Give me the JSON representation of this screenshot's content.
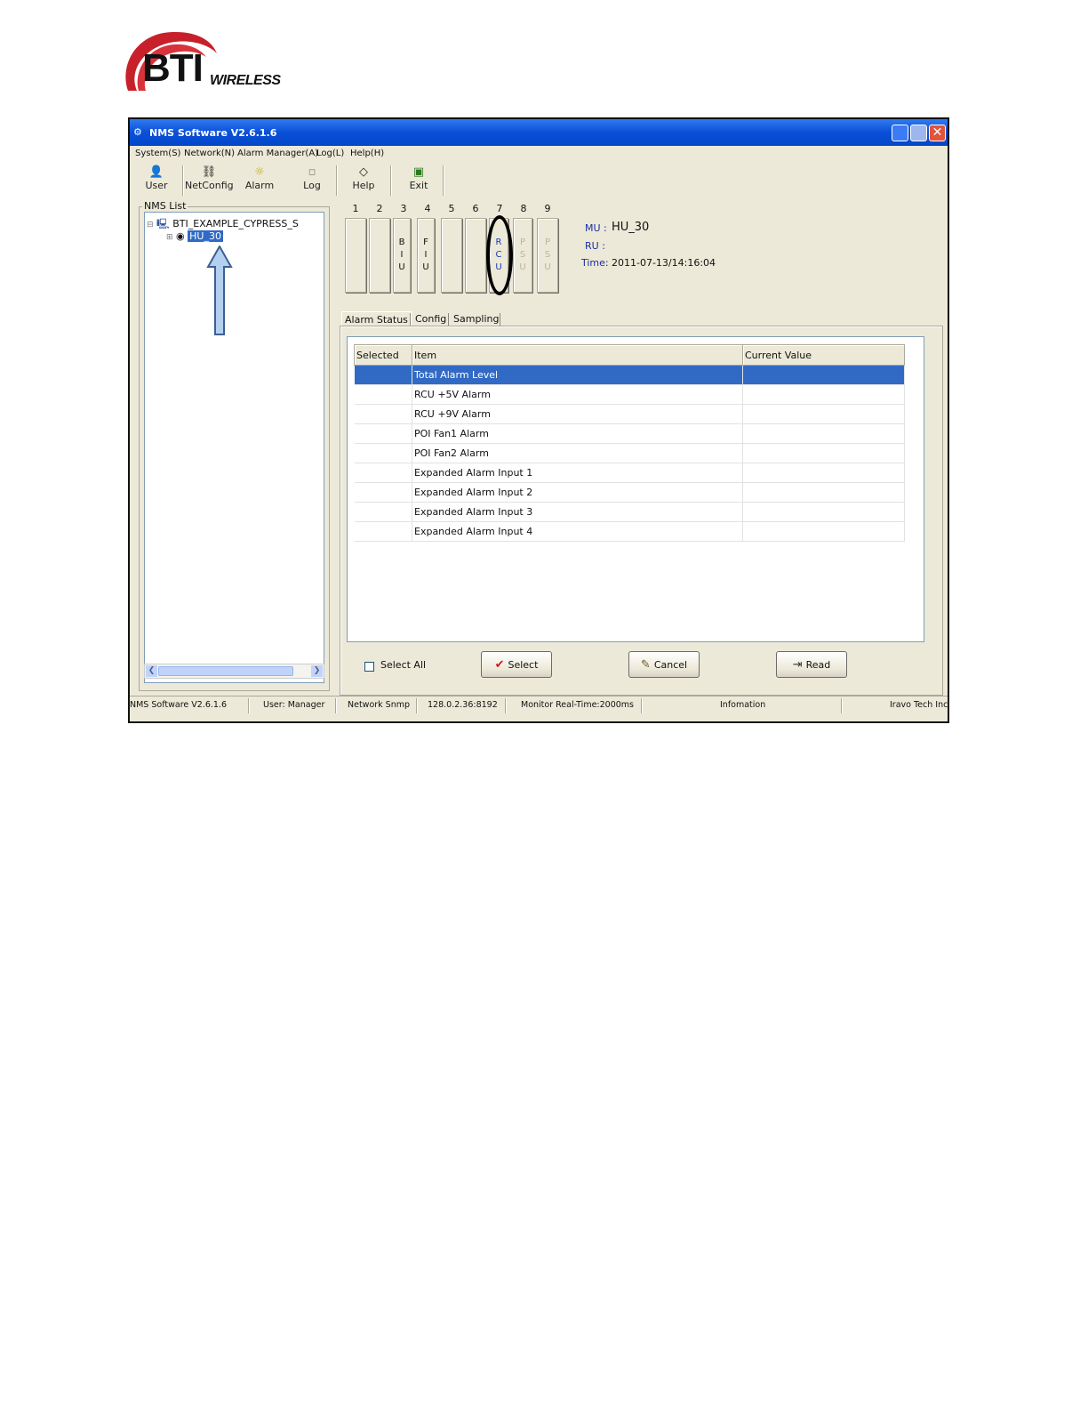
{
  "logo": {
    "brand": "BTI",
    "sub": "WIRELESS"
  },
  "window": {
    "title": "NMS Software V2.6.1.6",
    "close_glyph": "✕"
  },
  "menu": [
    "System(S)",
    "Network(N)",
    "Alarm Manager(A)",
    "Log(L)",
    "Help(H)"
  ],
  "toolbar": [
    {
      "label": "User",
      "icon": "user-icon"
    },
    {
      "label": "NetConfig",
      "icon": "network-icon"
    },
    {
      "label": "Alarm",
      "icon": "alarm-icon"
    },
    {
      "label": "Log",
      "icon": "log-icon"
    },
    {
      "label": "Help",
      "icon": "help-icon"
    },
    {
      "label": "Exit",
      "icon": "exit-icon"
    }
  ],
  "tree": {
    "label": "NMS List",
    "root": "BTI_EXAMPLE_CYPRESS_S",
    "child": "HU_30"
  },
  "slots": {
    "numbers": [
      "1",
      "2",
      "3",
      "4",
      "5",
      "6",
      "7",
      "8",
      "9"
    ],
    "cards": [
      {
        "text": ""
      },
      {
        "text": ""
      },
      {
        "text": "B I U"
      },
      {
        "text": "F I U"
      },
      {
        "text": ""
      },
      {
        "text": ""
      },
      {
        "text": "R C U"
      },
      {
        "text": "P S U"
      },
      {
        "text": "P S U"
      }
    ]
  },
  "info": {
    "mu_label": "MU :",
    "mu_value": "HU_30",
    "ru_label": "RU :",
    "time_label": "Time:",
    "time_value": "2011-07-13/14:16:04"
  },
  "tabs": [
    "Alarm Status",
    "Config",
    "Sampling"
  ],
  "table": {
    "headers": [
      "Selected",
      "Item",
      "Current Value"
    ],
    "rows": [
      {
        "item": "Total Alarm Level",
        "value": ""
      },
      {
        "item": "RCU +5V Alarm",
        "value": ""
      },
      {
        "item": "RCU +9V Alarm",
        "value": ""
      },
      {
        "item": "POI Fan1 Alarm",
        "value": ""
      },
      {
        "item": "POI Fan2 Alarm",
        "value": ""
      },
      {
        "item": "Expanded Alarm Input 1",
        "value": ""
      },
      {
        "item": "Expanded Alarm Input 2",
        "value": ""
      },
      {
        "item": "Expanded Alarm Input 3",
        "value": ""
      },
      {
        "item": "Expanded Alarm Input 4",
        "value": ""
      }
    ]
  },
  "buttons": {
    "select_all": "Select All",
    "select": "Select",
    "cancel": "Cancel",
    "read": "Read"
  },
  "status": {
    "app": "NMS Software V2.6.1.6",
    "user": "User: Manager",
    "network": "Network Snmp",
    "address": "128.0.2.36:8192",
    "monitor": "Monitor Real-Time:2000ms",
    "info": "Infomation",
    "company": "Iravo Tech Inc"
  },
  "colors": {
    "titlebar": "#0a4fd8",
    "selection": "#316ac5",
    "annotation_arrow": "#b4d0f0"
  }
}
